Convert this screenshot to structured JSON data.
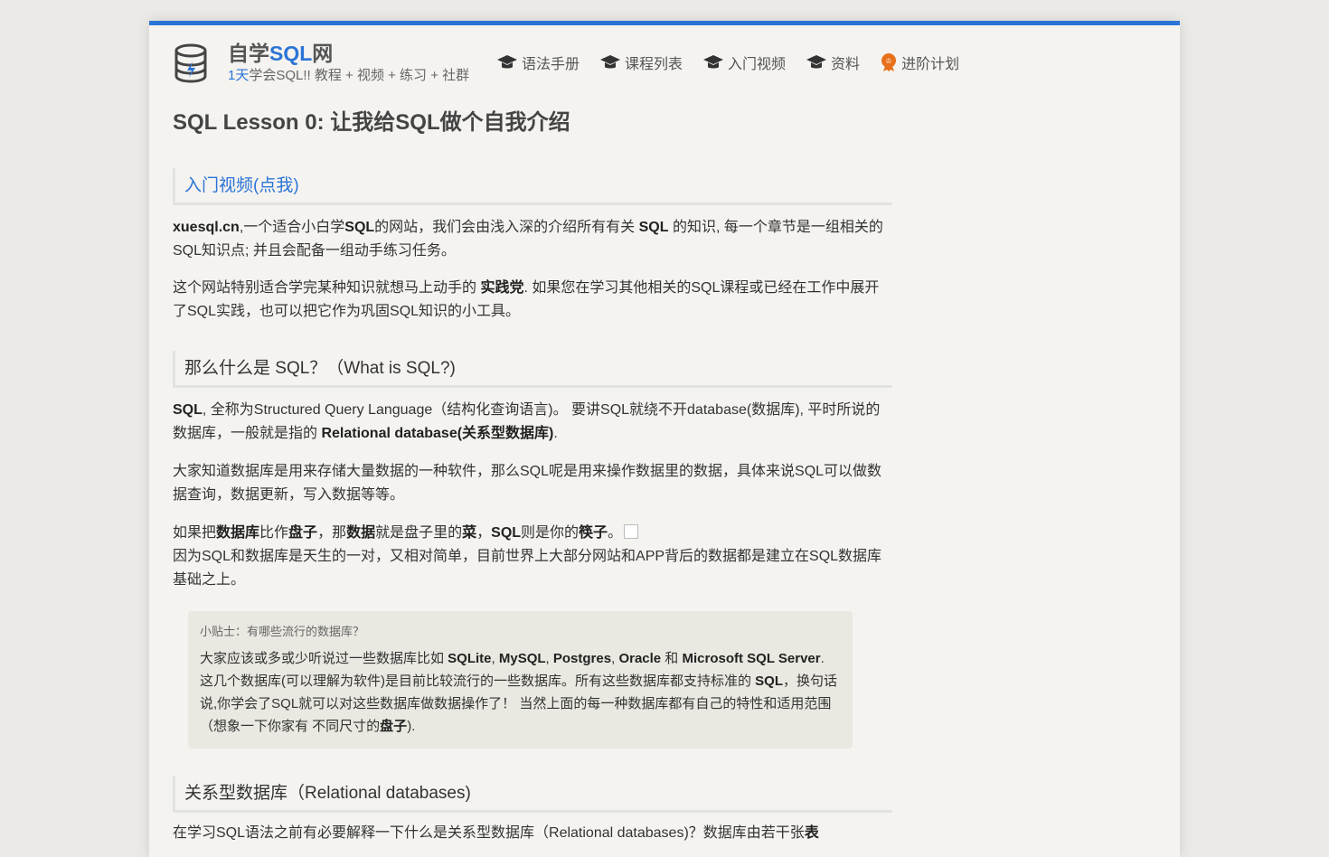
{
  "header": {
    "brand_part1": "自学",
    "brand_sql": "SQL",
    "brand_part2": "网",
    "tagline_hl": "1天",
    "tagline_rest": "学会SQL!! 教程 + 视频 + 练习 + 社群"
  },
  "nav": {
    "items": [
      {
        "label": "语法手册",
        "icon": "graduation-cap-icon"
      },
      {
        "label": "课程列表",
        "icon": "graduation-cap-icon"
      },
      {
        "label": "入门视频",
        "icon": "graduation-cap-icon"
      },
      {
        "label": "资料",
        "icon": "graduation-cap-icon"
      },
      {
        "label": "进阶计划",
        "icon": "badge-icon"
      }
    ]
  },
  "lesson": {
    "title": "SQL Lesson 0: 让我给SQL做个自我介绍",
    "video_link": "入门视频(点我)",
    "intro": {
      "site": "xuesql.cn",
      "t1": ",一个适合小白学",
      "b1": "SQL",
      "t2": "的网站，我们会由浅入深的介绍所有有关 ",
      "b2": "SQL",
      "t3": " 的知识, 每一个章节是一组相关的SQL知识点; 并且会配备一组动手练习任务。"
    },
    "para2": {
      "t1": "这个网站特别适合学完某种知识就想马上动手的 ",
      "b1": "实践党",
      "t2": ". 如果您在学习其他相关的SQL课程或已经在工作中展开了SQL实践，也可以把它作为巩固SQL知识的小工具。"
    },
    "section1_title": "那么什么是 SQL？（What is SQL?)",
    "para3": {
      "b1": "SQL",
      "t1": ", 全称为Structured Query Language（结构化查询语言)。 要讲SQL就绕不开database(数据库), 平时所说的数据库，一般就是指的 ",
      "b2": "Relational database(关系型数据库)",
      "t2": "."
    },
    "para4": "大家知道数据库是用来存储大量数据的一种软件，那么SQL呢是用来操作数据里的数据，具体来说SQL可以做数据查询，数据更新，写入数据等等。",
    "para5": {
      "t1": "如果把",
      "b1": "数据库",
      "t2": "比作",
      "b2": "盘子",
      "t3": "，那",
      "b3": "数据",
      "t4": "就是盘子里的",
      "b4": "菜",
      "t5": "，",
      "b5": "SQL",
      "t6": "则是你的",
      "b6": "筷子",
      "t7": "。",
      "line2": "因为SQL和数据库是天生的一对，又相对简单，目前世界上大部分网站和APP背后的数据都是建立在SQL数据库基础之上。"
    },
    "tip": {
      "title": "小贴士：有哪些流行的数据库？",
      "t1": "大家应该或多或少听说过一些数据库比如 ",
      "b1": "SQLite",
      "s1": ", ",
      "b2": "MySQL",
      "s2": ", ",
      "b3": "Postgres",
      "s3": ", ",
      "b4": "Oracle",
      "s4": " 和 ",
      "b5": "Microsoft SQL Server",
      "t2": ". 这几个数据库(可以理解为软件)是目前比较流行的一些数据库。所有这些数据库都支持标准的 ",
      "b6": "SQL",
      "t3": "，换句话说,你学会了SQL就可以对这些数据库做数据操作了！ 当然上面的每一种数据库都有自己的特性和适用范围（想象一下你家有 不同尺寸的",
      "b7": "盘子",
      "t4": ")."
    },
    "section2_title": "关系型数据库（Relational databases)",
    "para6": {
      "t1": "在学习SQL语法之前有必要解释一下什么是关系型数据库（Relational databases)？数据库由若干张",
      "b1": "表"
    }
  },
  "colors": {
    "accent": "#2b74d6",
    "badge": "#e8701a"
  }
}
